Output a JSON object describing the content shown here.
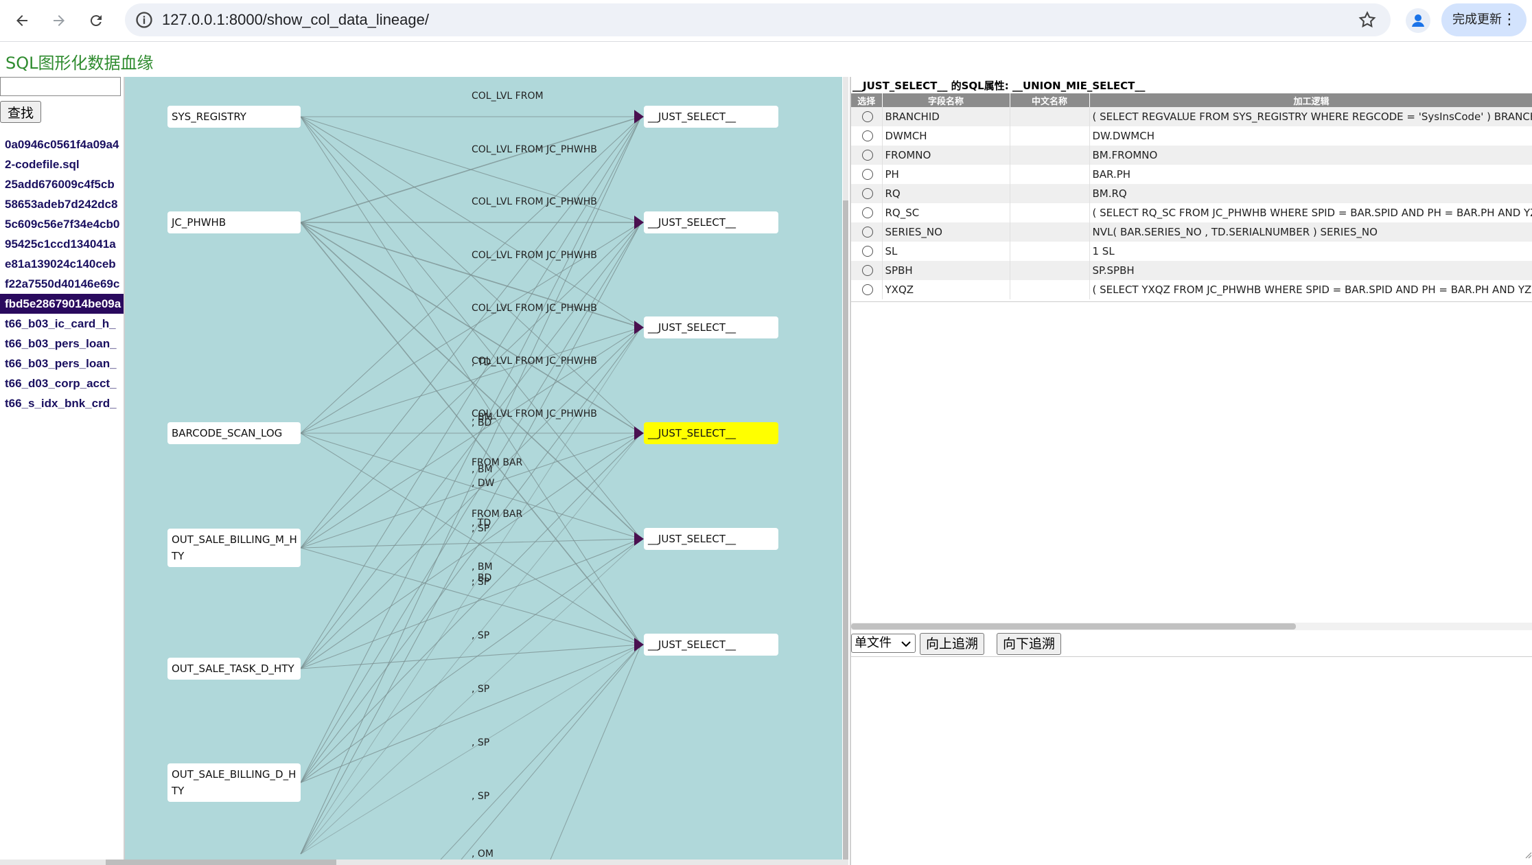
{
  "browser": {
    "url": "127.0.0.1:8000/show_col_data_lineage/",
    "update_label": "完成更新"
  },
  "page": {
    "title": "SQL图形化数据血缘",
    "search_value": "",
    "search_button": "查找"
  },
  "files": [
    "0a0946c0561f4a09a4",
    "2-codefile.sql",
    "25add676009c4f5cb",
    "58653adeb7d242dc8",
    "5c609c56e7f34e4cb0",
    "95425c1ccd134041a",
    "e81a139024c140ceb",
    "f22a7550d40146e69c",
    "fbd5e28679014be09a",
    "t66_b03_ic_card_h_",
    "t66_b03_pers_loan_",
    "t66_b03_pers_loan_",
    "t66_d03_corp_acct_",
    "t66_s_idx_bnk_crd_"
  ],
  "selected_file_index": 8,
  "graph": {
    "sources": [
      "SYS_REGISTRY",
      "JC_PHWHB",
      "BARCODE_SCAN_LOG",
      "OUT_SALE_BILLING_M_H\nTY",
      "OUT_SALE_TASK_D_HTY",
      "OUT_SALE_BILLING_D_H\nTY"
    ],
    "targets": [
      "__JUST_SELECT__",
      "__JUST_SELECT__",
      "__JUST_SELECT__",
      "__JUST_SELECT__",
      "__JUST_SELECT__",
      "__JUST_SELECT__"
    ],
    "highlighted_target_index": 3,
    "highlight_color": "#ffff00",
    "edge_labels": [
      "COL_LVL FROM",
      "COL_LVL FROM JC_PHWHB",
      "COL_LVL FROM JC_PHWHB",
      "COL_LVL FROM JC_PHWHB",
      "COL_LVL FROM JC_PHWHB",
      "COL_LVL FROM JC_PHWHB",
      "COL_LVL FROM JC_PHWHB",
      ", TD",
      ", BM",
      ", BD",
      "FROM BAR",
      ", BM",
      ", DW",
      "FROM BAR",
      ", TD",
      ", SP",
      ", BM",
      ", BD",
      ", SP",
      ", SP",
      ", SP",
      ", SP",
      ", SP",
      ", OM"
    ]
  },
  "properties": {
    "title": "__JUST_SELECT__ 的SQL属性:  __UNION_MIE_SELECT__",
    "headers": [
      "选择",
      "字段名称",
      "中文名称",
      "加工逻辑"
    ],
    "rows": [
      {
        "name": "BRANCHID",
        "cn": "",
        "logic": "( SELECT REGVALUE FROM SYS_REGISTRY WHERE REGCODE = 'SysInsCode' ) BRANCHID"
      },
      {
        "name": "DWMCH",
        "cn": "",
        "logic": "DW.DWMCH"
      },
      {
        "name": "FROMNO",
        "cn": "",
        "logic": "BM.FROMNO"
      },
      {
        "name": "PH",
        "cn": "",
        "logic": "BAR.PH"
      },
      {
        "name": "RQ",
        "cn": "",
        "logic": "BM.RQ"
      },
      {
        "name": "RQ_SC",
        "cn": "",
        "logic": "( SELECT RQ_SC FROM JC_PHWHB WHERE SPID = BAR.SPID AND PH = BAR.PH AND YZID"
      },
      {
        "name": "SERIES_NO",
        "cn": "",
        "logic": "NVL( BAR.SERIES_NO , TD.SERIALNUMBER ) SERIES_NO"
      },
      {
        "name": "SL",
        "cn": "",
        "logic": "1 SL"
      },
      {
        "name": "SPBH",
        "cn": "",
        "logic": "SP.SPBH"
      },
      {
        "name": "YXQZ",
        "cn": "",
        "logic": "( SELECT YXQZ FROM JC_PHWHB WHERE SPID = BAR.SPID AND PH = BAR.PH AND YZID"
      }
    ]
  },
  "toolbar": {
    "mode_selected": "单文件",
    "trace_up": "向上追溯",
    "trace_down": "向下追溯"
  },
  "colors": {
    "graph_bg": "#b0d8da",
    "title_green": "#2e8b2e",
    "selected_file_bg": "#2a0a5e",
    "edge": "#7a8f90",
    "arrow": "#4a1050"
  }
}
